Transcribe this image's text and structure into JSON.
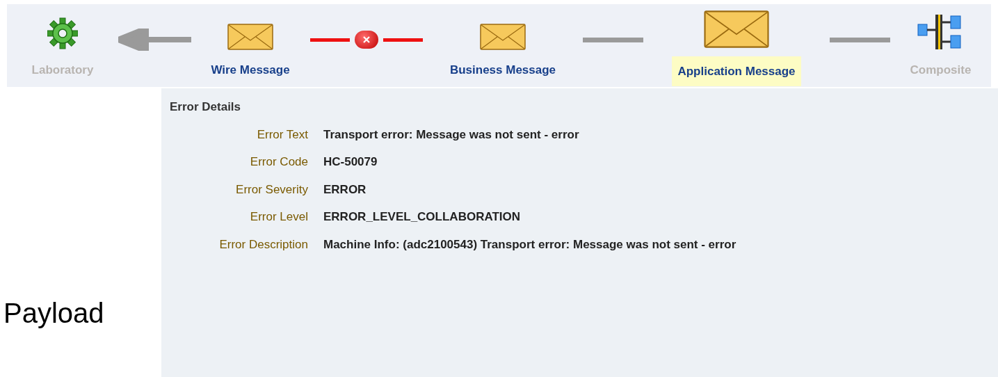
{
  "flow": {
    "nodes": [
      {
        "kind": "gear",
        "label": "Laboratory",
        "disabled": true,
        "selected": false
      },
      {
        "kind": "envelope",
        "label": "Wire Message",
        "disabled": false,
        "selected": false
      },
      {
        "kind": "envelope",
        "label": "Business Message",
        "disabled": false,
        "selected": false
      },
      {
        "kind": "envelope",
        "label": "Application Message",
        "disabled": false,
        "selected": true
      },
      {
        "kind": "composite",
        "label": "Composite",
        "disabled": true,
        "selected": false
      }
    ],
    "connectors": [
      {
        "kind": "arrow"
      },
      {
        "kind": "error"
      },
      {
        "kind": "line"
      },
      {
        "kind": "line"
      }
    ]
  },
  "error_details": {
    "title": "Error Details",
    "fields": [
      {
        "label": "Error Text",
        "value": "Transport error: Message was not sent - error"
      },
      {
        "label": "Error Code",
        "value": "HC-50079"
      },
      {
        "label": "Error Severity",
        "value": "ERROR"
      },
      {
        "label": "Error Level",
        "value": "ERROR_LEVEL_COLLABORATION"
      },
      {
        "label": "Error Description",
        "value": "Machine Info: (adc2100543) Transport error: Message was not sent - error"
      }
    ]
  },
  "payload": {
    "label": "Payload"
  }
}
